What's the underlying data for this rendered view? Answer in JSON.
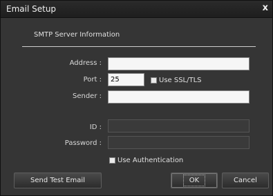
{
  "window": {
    "title": "Email Setup",
    "close_glyph": "x"
  },
  "section": {
    "title": "SMTP Server Information"
  },
  "fields": {
    "address": {
      "label": "Address :",
      "value": ""
    },
    "port": {
      "label": "Port :",
      "value": "25"
    },
    "ssl": {
      "label": "Use SSL/TLS",
      "checked": false
    },
    "sender": {
      "label": "Sender :",
      "value": ""
    },
    "id": {
      "label": "ID :",
      "value": ""
    },
    "password": {
      "label": "Password :",
      "value": ""
    },
    "auth": {
      "label": "Use Authentication",
      "checked": false
    }
  },
  "buttons": {
    "test": "Send Test Email",
    "ok": "OK",
    "cancel": "Cancel"
  }
}
